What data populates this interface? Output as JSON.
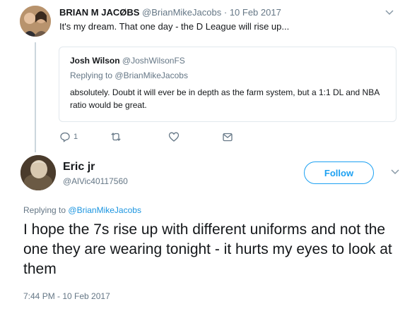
{
  "tweet1": {
    "name": "BRIAN M JACØBS",
    "handle": "@BrianMikeJacobs",
    "separator": "·",
    "date": "10 Feb 2017",
    "text": "It's my dream. That one day - the D League will rise up..."
  },
  "quote": {
    "name": "Josh Wilson",
    "handle": "@JoshWilsonFS",
    "replying_prefix": "Replying to",
    "replying_to": "@BrianMikeJacobs",
    "text": "absolutely. Doubt it will ever be in depth as the farm system, but a 1:1 DL and NBA ratio would be great."
  },
  "actions": {
    "reply_count": "1",
    "icons": [
      "reply-icon",
      "retweet-icon",
      "like-icon",
      "message-icon"
    ]
  },
  "tweet2": {
    "name": "Eric jr",
    "handle": "@AlVic40117560",
    "follow_label": "Follow",
    "replying_prefix": "Replying to",
    "replying_to": "@BrianMikeJacobs",
    "text": "I hope the 7s rise up with different uniforms and not the one they are wearing tonight - it hurts my eyes to look at them",
    "timestamp": "7:44 PM - 10 Feb 2017"
  },
  "colors": {
    "accent": "#1da1f2",
    "mention": "#1b95e0",
    "secondary_text": "#657786",
    "primary_text": "#14171a",
    "border": "#e1e8ed"
  }
}
